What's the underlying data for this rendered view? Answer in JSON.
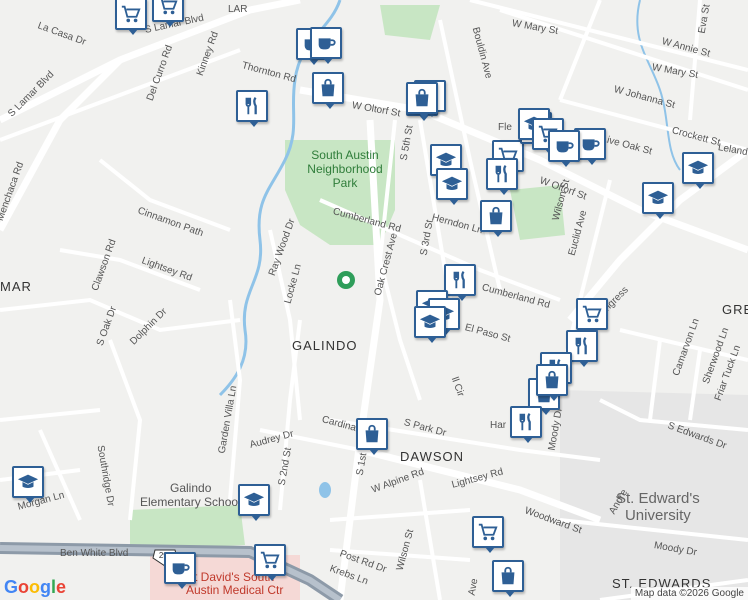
{
  "map": {
    "colors": {
      "background": "#f1f1ef",
      "road": "#ffffff",
      "park": "#c8e6c4",
      "water": "#8fc3e8",
      "highway": "#8d9aa8",
      "marker": "#2e5f95"
    },
    "streets": [
      {
        "id": "s-lamar-blvd",
        "text": "S Lamar Blvd"
      },
      {
        "id": "s-lamar-blvd-2",
        "text": "S Lamar Blvd"
      },
      {
        "id": "la-casa-dr",
        "text": "La Casa Dr"
      },
      {
        "id": "del-curro-rd",
        "text": "Del Curro Rd"
      },
      {
        "id": "kinney-rd",
        "text": "Kinney Rd"
      },
      {
        "id": "thornton-rd",
        "text": "Thornton Rd"
      },
      {
        "id": "menchaca-rd",
        "text": "Menchaca Rd"
      },
      {
        "id": "cinnamon-path",
        "text": "Cinnamon Path"
      },
      {
        "id": "lightsey-rd",
        "text": "Lightsey Rd"
      },
      {
        "id": "clawson-rd",
        "text": "Clawson Rd"
      },
      {
        "id": "s-oak-dr",
        "text": "S Oak Dr"
      },
      {
        "id": "dolphin-dr",
        "text": "Dolphin Dr"
      },
      {
        "id": "southridge-dr",
        "text": "Southridge Dr"
      },
      {
        "id": "ray-wood-dr",
        "text": "Ray Wood Dr"
      },
      {
        "id": "locke-ln",
        "text": "Locke Ln"
      },
      {
        "id": "w-oltorf-st",
        "text": "W Oltorf St"
      },
      {
        "id": "w-oltorf-st-2",
        "text": "W Oltorf St"
      },
      {
        "id": "s-5th-st",
        "text": "S 5th St"
      },
      {
        "id": "bouldin-ave",
        "text": "Bouldin Ave"
      },
      {
        "id": "w-mary-st",
        "text": "W Mary St"
      },
      {
        "id": "w-mary-st-2",
        "text": "W Mary St"
      },
      {
        "id": "w-annie-st",
        "text": "W Annie St"
      },
      {
        "id": "eva-st",
        "text": "Eva St"
      },
      {
        "id": "w-johanna-st",
        "text": "W Johanna St"
      },
      {
        "id": "w-live-oak-st",
        "text": "W Live Oak St"
      },
      {
        "id": "crockett-st",
        "text": "Crockett St"
      },
      {
        "id": "leland",
        "text": "Leland"
      },
      {
        "id": "herndon-ln",
        "text": "Herndon Ln"
      },
      {
        "id": "cumberland-rd",
        "text": "Cumberland Rd"
      },
      {
        "id": "cumberland-rd-2",
        "text": "Cumberland Rd"
      },
      {
        "id": "oak-crest-ave",
        "text": "Oak Crest Ave"
      },
      {
        "id": "s-3rd-st",
        "text": "S 3rd St"
      },
      {
        "id": "wilson-st",
        "text": "Wilson St"
      },
      {
        "id": "euclid-ave",
        "text": "Euclid Ave"
      },
      {
        "id": "el-paso-st",
        "text": "El Paso St"
      },
      {
        "id": "s-congress",
        "text": "S Congress"
      },
      {
        "id": "camaron-ln",
        "text": "Camarvon Ln"
      },
      {
        "id": "sherwood-ln",
        "text": "Sherwood Ln"
      },
      {
        "id": "friar-tuck-ln",
        "text": "Friar Tuck Ln"
      },
      {
        "id": "s-park-dr",
        "text": "S Park Dr"
      },
      {
        "id": "cardinal",
        "text": "Cardinal"
      },
      {
        "id": "garden-villa-ln",
        "text": "Garden Villa Ln"
      },
      {
        "id": "audrey-dr",
        "text": "Audrey Dr"
      },
      {
        "id": "s-2nd-st",
        "text": "S 2nd St"
      },
      {
        "id": "s-1st",
        "text": "S 1st"
      },
      {
        "id": "w-alpine-rd",
        "text": "W Alpine Rd"
      },
      {
        "id": "lightsey-rd-2",
        "text": "Lightsey Rd"
      },
      {
        "id": "woodward-st",
        "text": "Woodward St"
      },
      {
        "id": "moody-dr",
        "text": "Moody Dr"
      },
      {
        "id": "moody-dr-2",
        "text": "Moody Dr"
      },
      {
        "id": "s-edwards-dr",
        "text": "S Edwards Dr"
      },
      {
        "id": "andre",
        "text": "Andre"
      },
      {
        "id": "post-rd-dr",
        "text": "Post Rd Dr"
      },
      {
        "id": "krebs-ln",
        "text": "Krebs Ln"
      },
      {
        "id": "wilson-st-2",
        "text": "Wilson St"
      },
      {
        "id": "morgan-ln",
        "text": "Morgan Ln"
      },
      {
        "id": "ben-white-blvd",
        "text": "Ben White Blvd"
      },
      {
        "id": "ave",
        "text": "Ave"
      },
      {
        "id": "har",
        "text": "Har"
      },
      {
        "id": "ll-cir",
        "text": "ll Cir"
      },
      {
        "id": "flo",
        "text": "Fle"
      },
      {
        "id": "w-o",
        "text": "W O"
      },
      {
        "id": "lar",
        "text": "LAR"
      }
    ],
    "areas": {
      "galindo": "GALINDO",
      "dawson": "DAWSON",
      "st_edwards": "ST. EDWARDS",
      "mar": "MAR",
      "gre": "GRE"
    },
    "places": {
      "park_line1": "South Austin",
      "park_line2": "Neighborhood",
      "park_line3": "Park",
      "school_line1": "Galindo",
      "school_line2": "Elementary School",
      "univ_line1": "St. Edward's",
      "univ_line2": "University",
      "hosp_line1": "St David's South",
      "hosp_line2": "Austin Medical Ctr",
      "highway_shield": "290"
    },
    "branding": {
      "logo": "Google",
      "attribution": "Map data ©2026 Google"
    },
    "markers": [
      {
        "type": "grocery",
        "icon": "cart-icon"
      },
      {
        "type": "grocery",
        "icon": "cart-icon"
      },
      {
        "type": "cafe",
        "icon": "coffee-cup-icon"
      },
      {
        "type": "cafe",
        "icon": "coffee-cup-icon"
      },
      {
        "type": "shopping",
        "icon": "shopping-bag-icon"
      },
      {
        "type": "restaurant",
        "icon": "fork-knife-icon"
      },
      {
        "type": "shopping",
        "icon": "shopping-bag-icon"
      },
      {
        "type": "restaurant",
        "icon": "fork-knife-icon"
      },
      {
        "type": "shopping",
        "icon": "shopping-bag-icon"
      },
      {
        "type": "cafe",
        "icon": "coffee-cup-icon"
      },
      {
        "type": "school",
        "icon": "graduation-cap-icon"
      },
      {
        "type": "grocery",
        "icon": "cart-icon"
      },
      {
        "type": "restaurant",
        "icon": "fork-knife-icon"
      },
      {
        "type": "school",
        "icon": "graduation-cap-icon"
      },
      {
        "type": "shopping",
        "icon": "shopping-bag-icon"
      },
      {
        "type": "grocery",
        "icon": "cart-icon"
      },
      {
        "type": "school",
        "icon": "graduation-cap-icon"
      },
      {
        "type": "grocery",
        "icon": "cart-icon"
      },
      {
        "type": "cafe",
        "icon": "coffee-cup-icon"
      },
      {
        "type": "school",
        "icon": "graduation-cap-icon"
      },
      {
        "type": "school",
        "icon": "graduation-cap-icon"
      },
      {
        "type": "restaurant",
        "icon": "fork-knife-icon"
      },
      {
        "type": "school",
        "icon": "graduation-cap-icon"
      },
      {
        "type": "school",
        "icon": "graduation-cap-icon"
      },
      {
        "type": "school",
        "icon": "graduation-cap-icon"
      },
      {
        "type": "grocery",
        "icon": "cart-icon"
      },
      {
        "type": "restaurant",
        "icon": "fork-knife-icon"
      },
      {
        "type": "restaurant",
        "icon": "fork-knife-icon"
      },
      {
        "type": "shopping",
        "icon": "shopping-bag-icon"
      },
      {
        "type": "shopping",
        "icon": "shopping-bag-icon"
      },
      {
        "type": "restaurant",
        "icon": "fork-knife-icon"
      },
      {
        "type": "shopping",
        "icon": "shopping-bag-icon"
      },
      {
        "type": "school",
        "icon": "graduation-cap-icon"
      },
      {
        "type": "school",
        "icon": "graduation-cap-icon"
      },
      {
        "type": "grocery",
        "icon": "cart-icon"
      },
      {
        "type": "grocery",
        "icon": "cart-icon"
      },
      {
        "type": "cafe",
        "icon": "coffee-cup-icon"
      },
      {
        "type": "shopping",
        "icon": "shopping-bag-icon"
      }
    ]
  }
}
